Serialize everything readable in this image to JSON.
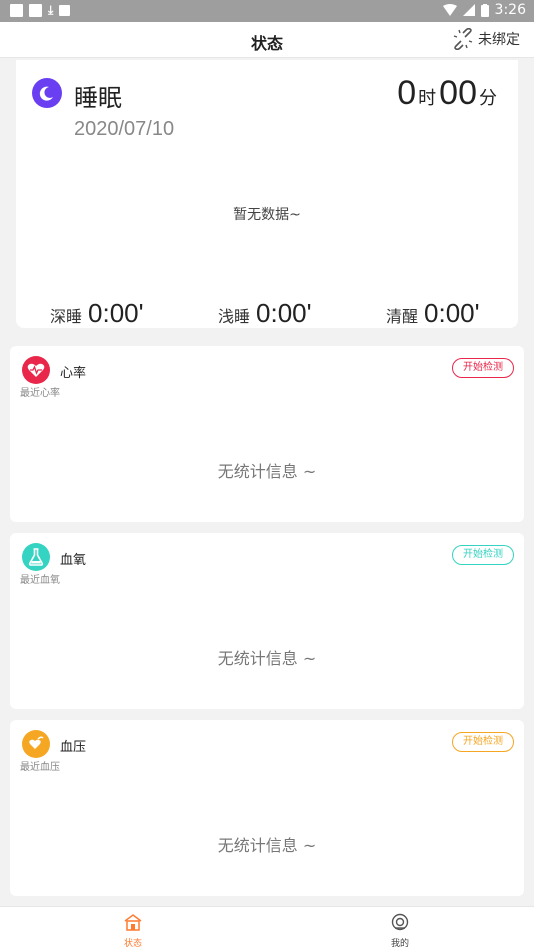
{
  "status_bar": {
    "time": "3:26"
  },
  "header": {
    "title": "状态",
    "unbind_label": "未绑定"
  },
  "sleep": {
    "title": "睡眠",
    "date": "2020/07/10",
    "hours": "0",
    "hours_unit": "时",
    "minutes": "00",
    "minutes_unit": "分",
    "empty_text": "暂无数据~",
    "deep_label": "深睡",
    "deep_value": "0:00'",
    "light_label": "浅睡",
    "light_value": "0:00'",
    "awake_label": "清醒",
    "awake_value": "0:00'"
  },
  "metrics": [
    {
      "title": "心率",
      "subtitle": "最近心率",
      "button": "开始检测",
      "empty": "无统计信息 ~",
      "color": "#e8274a",
      "icon": "heart-icon"
    },
    {
      "title": "血氧",
      "subtitle": "最近血氧",
      "button": "开始检测",
      "empty": "无统计信息 ~",
      "color": "#35d3c1",
      "icon": "flask-icon"
    },
    {
      "title": "血压",
      "subtitle": "最近血压",
      "button": "开始检测",
      "empty": "无统计信息 ~",
      "color": "#f5a623",
      "icon": "blood-pressure-icon"
    }
  ],
  "tabs": [
    {
      "label": "状态",
      "active": true,
      "icon": "home-icon",
      "color": "#ff7a2f"
    },
    {
      "label": "我的",
      "active": false,
      "icon": "profile-icon",
      "color": "#666666"
    }
  ]
}
